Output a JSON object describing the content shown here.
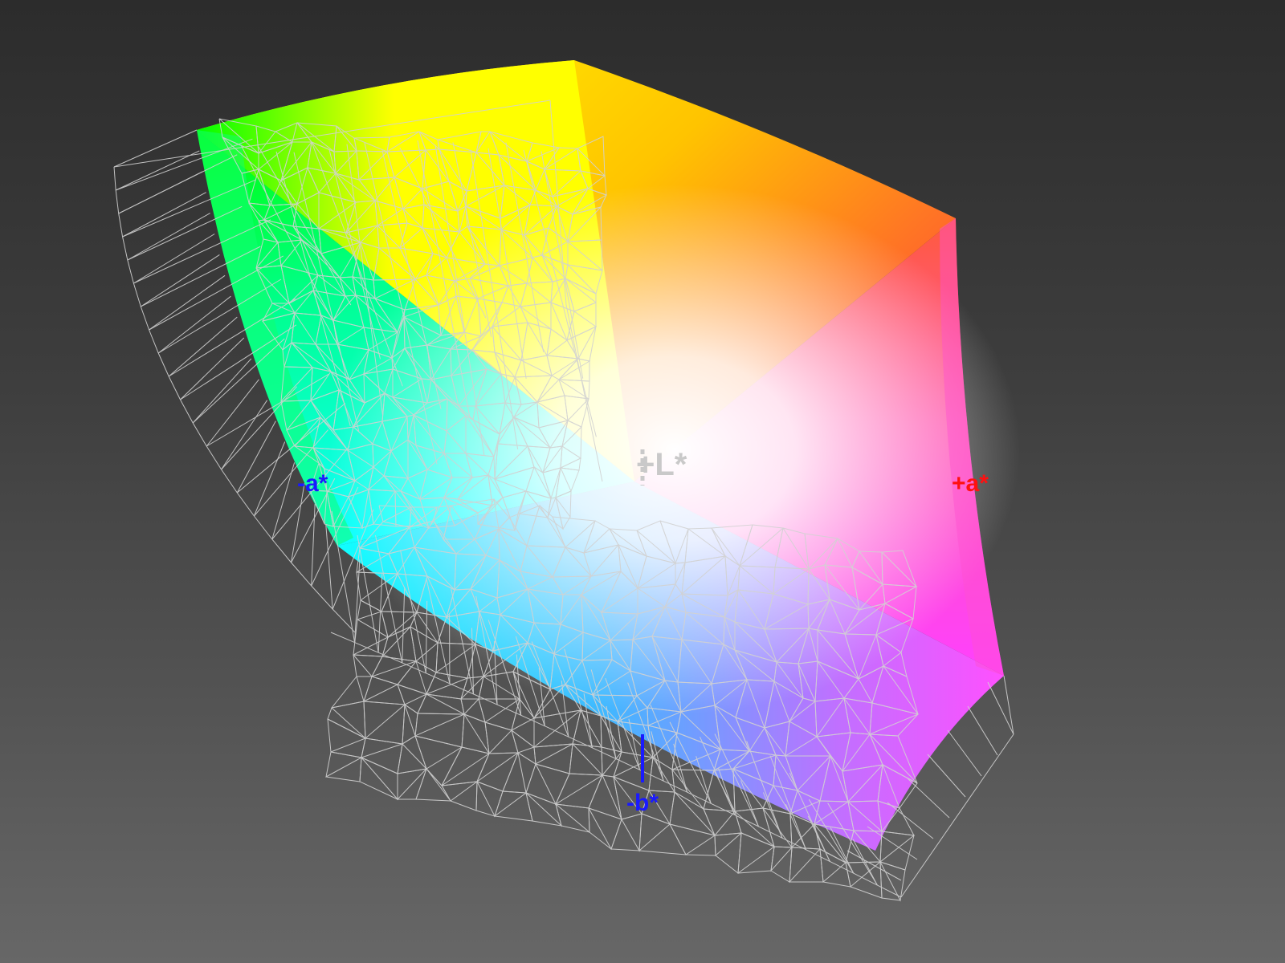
{
  "axes": {
    "l_plus": {
      "label": "+L*",
      "color": "#c9c9c9"
    },
    "a_plus": {
      "label": "+a*",
      "color": "#ff1010"
    },
    "a_minus": {
      "label": "-a*",
      "color": "#1a1aff"
    },
    "b_minus": {
      "label": "-b*",
      "color": "#1a1aff"
    }
  },
  "colors": {
    "background_top": "#2c2c2c",
    "background_bottom": "#676767",
    "wireframe": "#d2d2d2",
    "green": "#00ff00",
    "yellow": "#ffff00",
    "orange": "#ffa000",
    "red": "#ff5a3c",
    "magenta": "#ff40ff",
    "purple": "#b060ff",
    "blue": "#40b0ff",
    "cyan": "#10ffff",
    "white": "#ffffff"
  }
}
